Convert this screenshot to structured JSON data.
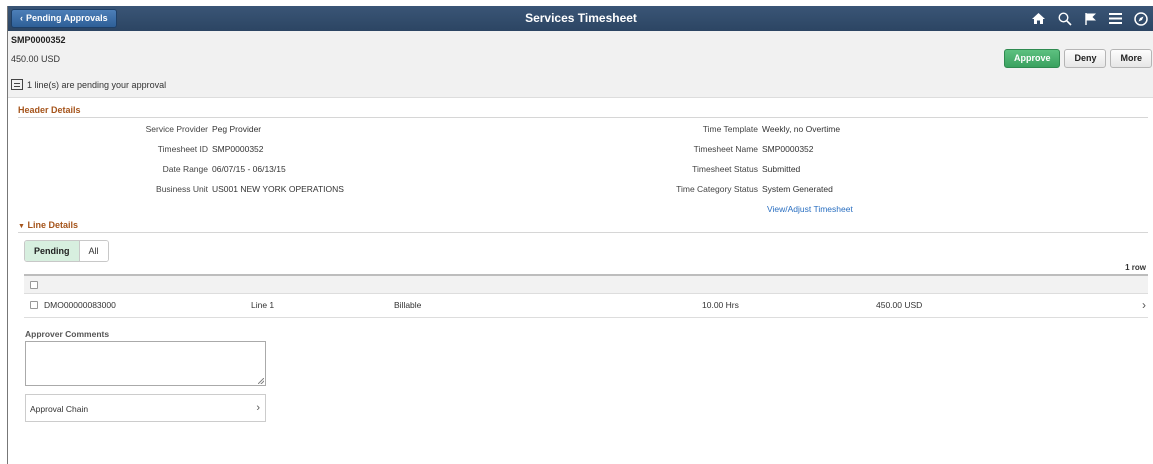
{
  "banner": {
    "back_label": "Pending Approvals",
    "title": "Services Timesheet",
    "icons": [
      "home-icon",
      "search-icon",
      "flag-icon",
      "menu-icon",
      "compass-icon"
    ]
  },
  "summary": {
    "timesheet_id": "SMP0000352",
    "amount": "450.00  USD",
    "pending_text": "1 line(s) are pending your approval"
  },
  "actions": {
    "approve": "Approve",
    "deny": "Deny",
    "more": "More"
  },
  "header_details": {
    "title": "Header Details",
    "left": [
      {
        "label": "Service Provider",
        "value": "Peg Provider"
      },
      {
        "label": "Timesheet ID",
        "value": "SMP0000352"
      },
      {
        "label": "Date Range",
        "value": "06/07/15  -  06/13/15"
      },
      {
        "label": "Business Unit",
        "value": "US001 NEW YORK OPERATIONS"
      }
    ],
    "right": [
      {
        "label": "Time Template",
        "value": "Weekly, no Overtime"
      },
      {
        "label": "Timesheet Name",
        "value": "SMP0000352"
      },
      {
        "label": "Timesheet Status",
        "value": "Submitted"
      },
      {
        "label": "Time Category Status",
        "value": "System Generated"
      }
    ],
    "link": "View/Adjust Timesheet"
  },
  "line_details": {
    "title": "Line Details",
    "tabs": {
      "pending": "Pending",
      "all": "All"
    },
    "row_count": "1 row",
    "rows": [
      {
        "id": "DMO00000083000",
        "line": "Line  1",
        "type": "Billable",
        "hours": "10.00 Hrs",
        "amount": "450.00 USD"
      }
    ]
  },
  "comments": {
    "label": "Approver Comments",
    "value": ""
  },
  "approval_chain": {
    "label": "Approval Chain"
  },
  "colors": {
    "banner": "#2c4563",
    "section_title": "#a5541b",
    "approve": "#3aa15f",
    "link": "#2a6fc1"
  }
}
